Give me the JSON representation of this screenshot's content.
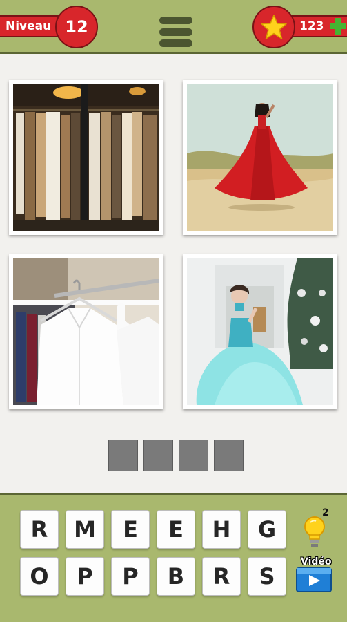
{
  "header": {
    "level_label": "Niveau",
    "level_number": "12",
    "coins": "123",
    "menu_icon": "hamburger-icon",
    "star_icon": "star-icon",
    "add_coins_icon": "plus-icon"
  },
  "puzzle": {
    "pictures": [
      {
        "subject": "clothes-rack-photo"
      },
      {
        "subject": "woman-red-dress-photo"
      },
      {
        "subject": "white-shirt-hanger-photo"
      },
      {
        "subject": "woman-blue-gown-photo"
      }
    ],
    "answer_length": 4
  },
  "keyboard": {
    "row1": [
      "R",
      "M",
      "E",
      "E",
      "H",
      "G"
    ],
    "row2": [
      "O",
      "P",
      "P",
      "B",
      "R",
      "S"
    ],
    "hint_count": "2",
    "hint_icon": "lightbulb-icon",
    "video_label": "Vidéo",
    "video_icon": "video-play-icon"
  },
  "colors": {
    "bar_green": "#a9b86e",
    "accent_red": "#d8262b",
    "slot_gray": "#7a7a7a",
    "plus_green": "#46b432",
    "star_yellow": "#ffd21c"
  }
}
